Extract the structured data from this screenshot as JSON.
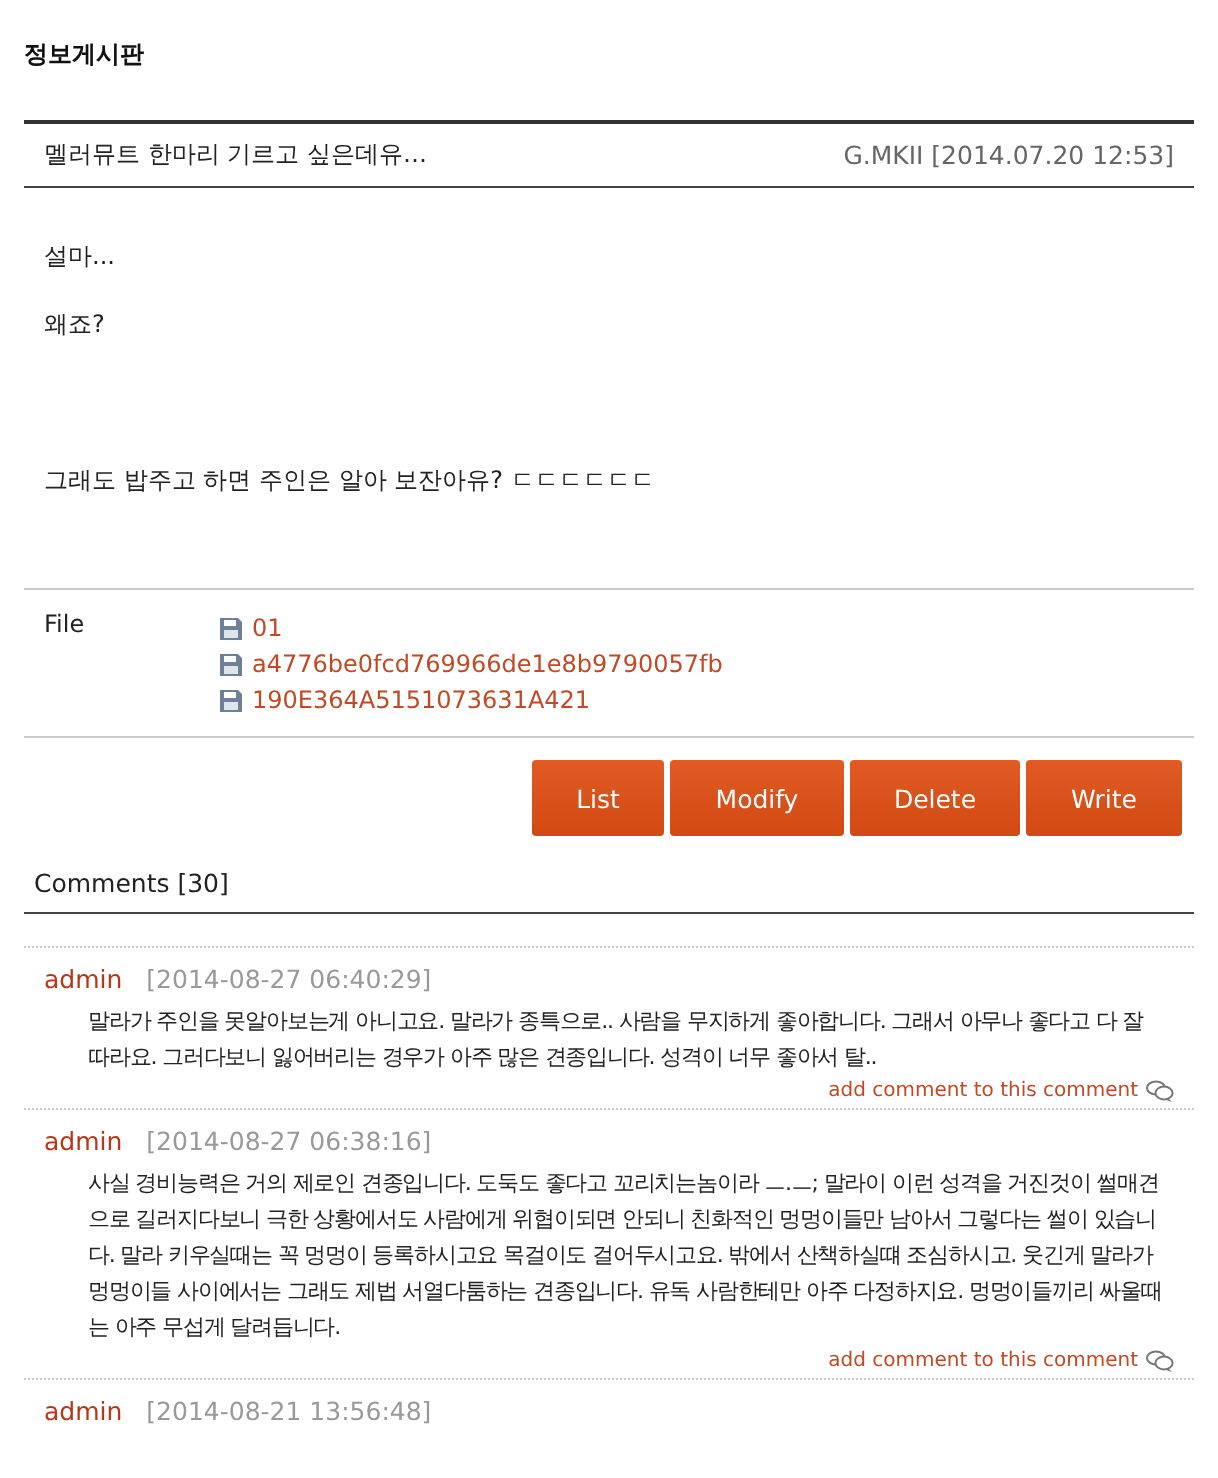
{
  "board_title": "정보게시판",
  "post": {
    "title": "멜러뮤트 한마리 기르고 싶은데유…",
    "author_date": "G.MKII [2014.07.20 12:53]",
    "body": [
      "설마...",
      "왜죠?",
      "그래도 밥주고 하면 주인은 알아 보잔아유? ㄷㄷㄷㄷㄷㄷ"
    ]
  },
  "files": {
    "label": "File",
    "items": [
      "01",
      "a4776be0fcd769966de1e8b9790057fb",
      "190E364A5151073631A421"
    ]
  },
  "buttons": [
    "List",
    "Modify",
    "Delete",
    "Write"
  ],
  "comments_header": "Comments [30]",
  "comments": [
    {
      "author": "admin",
      "date": "[2014-08-27 06:40:29]",
      "text": "말라가 주인을 못알아보는게 아니고요. 말라가 종특으로.. 사람을 무지하게 좋아합니다. 그래서 아무나 좋다고 다 잘따라요. 그러다보니 잃어버리는 경우가 아주 많은 견종입니다. 성격이 너무 좋아서 탈..",
      "reply": "add comment to this comment"
    },
    {
      "author": "admin",
      "date": "[2014-08-27 06:38:16]",
      "text": "사실 경비능력은 거의 제로인 견종입니다. 도둑도 좋다고 꼬리치는놈이라 ㅡ.ㅡ; 말라이 이런 성격을 거진것이 썰매견으로 길러지다보니 극한 상황에서도 사람에게 위협이되면 안되니 친화적인 멍멍이들만 남아서 그렇다는 썰이 있습니다. 말라 키우실때는 꼭 멍멍이 등록하시고요 목걸이도 걸어두시고요. 밖에서 산책하실떄 조심하시고. 웃긴게 말라가 멍멍이들 사이에서는 그래도 제법 서열다툼하는 견종입니다. 유독 사람한테만 아주 다정하지요. 멍멍이들끼리 싸울때는 아주 무섭게 달려듭니다.",
      "reply": "add comment to this comment"
    },
    {
      "author": "admin",
      "date": "[2014-08-21 13:56:48]"
    }
  ]
}
